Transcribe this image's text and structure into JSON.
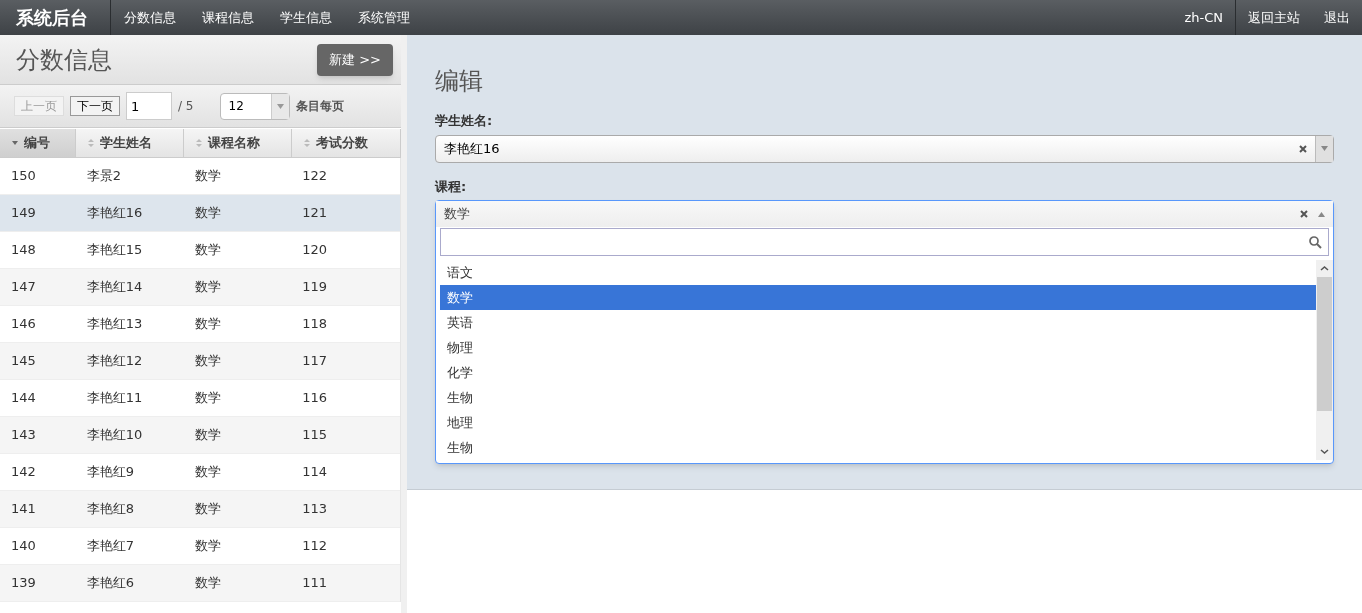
{
  "navbar": {
    "brand": "系统后台",
    "items": [
      {
        "label": "分数信息"
      },
      {
        "label": "课程信息"
      },
      {
        "label": "学生信息"
      },
      {
        "label": "系统管理"
      }
    ],
    "right_items": [
      {
        "label": "zh-CN"
      },
      {
        "label": "返回主站"
      },
      {
        "label": "退出"
      }
    ]
  },
  "list_panel": {
    "title": "分数信息",
    "new_button": "新建 >>",
    "pager": {
      "prev": "上一页",
      "prev_disabled": true,
      "next": "下一页",
      "page": "1",
      "total": "/ 5",
      "page_size": "12",
      "page_size_label": "条目每页"
    },
    "columns": [
      {
        "label": "编号",
        "sorted": true
      },
      {
        "label": "学生姓名",
        "sorted": false
      },
      {
        "label": "课程名称",
        "sorted": false
      },
      {
        "label": "考试分数",
        "sorted": false
      }
    ],
    "rows": [
      {
        "cells": [
          "150",
          "李景2",
          "数学",
          "122"
        ],
        "selected": false
      },
      {
        "cells": [
          "149",
          "李艳红16",
          "数学",
          "121"
        ],
        "selected": true
      },
      {
        "cells": [
          "148",
          "李艳红15",
          "数学",
          "120"
        ],
        "selected": false
      },
      {
        "cells": [
          "147",
          "李艳红14",
          "数学",
          "119"
        ],
        "selected": false
      },
      {
        "cells": [
          "146",
          "李艳红13",
          "数学",
          "118"
        ],
        "selected": false
      },
      {
        "cells": [
          "145",
          "李艳红12",
          "数学",
          "117"
        ],
        "selected": false
      },
      {
        "cells": [
          "144",
          "李艳红11",
          "数学",
          "116"
        ],
        "selected": false
      },
      {
        "cells": [
          "143",
          "李艳红10",
          "数学",
          "115"
        ],
        "selected": false
      },
      {
        "cells": [
          "142",
          "李艳红9",
          "数学",
          "114"
        ],
        "selected": false
      },
      {
        "cells": [
          "141",
          "李艳红8",
          "数学",
          "113"
        ],
        "selected": false
      },
      {
        "cells": [
          "140",
          "李艳红7",
          "数学",
          "112"
        ],
        "selected": false
      },
      {
        "cells": [
          "139",
          "李艳红6",
          "数学",
          "111"
        ],
        "selected": false
      }
    ]
  },
  "edit_panel": {
    "title": "编辑",
    "student_label": "学生姓名:",
    "student_value": "李艳红16",
    "course_label": "课程:",
    "course_value": "数学",
    "course_expanded": true,
    "options": [
      {
        "label": "语文",
        "selected": false
      },
      {
        "label": "数学",
        "selected": true
      },
      {
        "label": "英语",
        "selected": false
      },
      {
        "label": "物理",
        "selected": false
      },
      {
        "label": "化学",
        "selected": false
      },
      {
        "label": "生物",
        "selected": false
      },
      {
        "label": "地理",
        "selected": false
      },
      {
        "label": "生物",
        "selected": false
      }
    ]
  }
}
